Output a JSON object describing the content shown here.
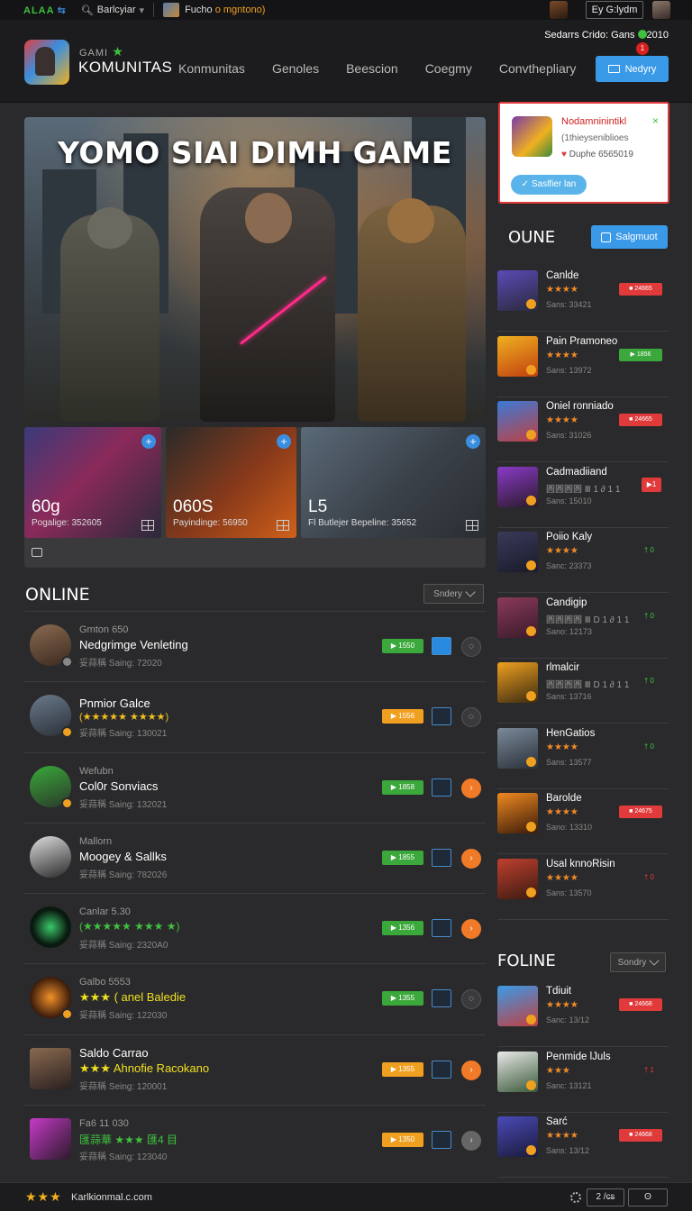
{
  "topbar": {
    "logo": "ALAA",
    "search_label": "Barlcyiar",
    "tab_text_prefix": "Fucho",
    "tab_text_suffix": "o mgntono)",
    "user_box": "Ey G:lydm"
  },
  "header": {
    "brand_small": "GAMI",
    "brand_title": "KOMUNITAS",
    "nav": [
      "Konmunitas",
      "Genoles",
      "Beescion",
      "Coegmy",
      "Convthepliary"
    ],
    "status": "Sedarrs Crido: Gans",
    "status_year": "2010",
    "notif_count": "1",
    "cta_label": "Nedyry"
  },
  "hero": {
    "title": "YOMO SIAI DIMH GAME"
  },
  "thumbs": [
    {
      "big": "60g",
      "sub": "Pogalige: 352605"
    },
    {
      "big": "060S",
      "sub": "Payindinge: 56950"
    },
    {
      "big": "L5",
      "sub": "Fl Butlejer Bepeline: 35652"
    }
  ],
  "online": {
    "title": "ONLINE",
    "sort_label": "Sndery",
    "rows": [
      {
        "pre": "Gmton 650",
        "name": "Nedgrimge Venleting",
        "meta": "妥蒜稱 Saing: 72020",
        "tag": "▶ 1550",
        "tag_color": "#3aa83a",
        "circle": "",
        "circle_style": ""
      },
      {
        "pre": "",
        "name": "Pnmior Galce",
        "stars": "(★★★★★ ★★★★)",
        "meta": "妥蒜稱 Saing: 130021",
        "tag": "▶ 1556",
        "tag_color": "#f0a020",
        "circle": "",
        "circle_style": ""
      },
      {
        "pre": "Wefubn",
        "name": "Col0r Sonviacs",
        "meta": "妥蒜稱 Saing: 132021",
        "tag": "▶ 1858",
        "tag_color": "#3aa83a",
        "circle": "›",
        "circle_style": "orange"
      },
      {
        "pre": "Mallorn",
        "name": "Moogey & Sallks",
        "meta": "妥蒜稱 Saing: 782026",
        "tag": "▶ 1855",
        "tag_color": "#3aa83a",
        "circle": "›",
        "circle_style": "orange"
      },
      {
        "pre": "Canlar 5.30",
        "name": "",
        "stars": "(★★★★★ ★★★ ★)",
        "meta": "妥蒜稱 Saing: 2320A0",
        "tag": "▶ 1356",
        "tag_color": "#3aa83a",
        "circle": "›",
        "circle_style": "orange"
      },
      {
        "pre": "Galbo 5553",
        "name": "★★★ ( anel Baledie",
        "meta": "妥蒜稱 Saing: 122030",
        "tag": "▶ 1355",
        "tag_color": "#3aa83a",
        "circle": "",
        "circle_style": ""
      },
      {
        "pre": "",
        "name": "Saldo Carrao",
        "name2": "★★★ Ahnofie Racokano",
        "meta": "妥蒜稱 Seing: 120001",
        "tag": "▶ 1355",
        "tag_color": "#f0a020",
        "circle": "›",
        "circle_style": "orange"
      },
      {
        "pre": "Fa6 11 030",
        "name": "",
        "stars": "匯蒜華 ★★★ 匯4 目",
        "meta": "妥蒜稱 Saing: 123040",
        "tag": "▶ 1350",
        "tag_color": "#f0a020",
        "circle": "›",
        "circle_style": "grey"
      }
    ]
  },
  "notification": {
    "title": "Nodamninintikl",
    "line2": "(1thieyseniblioes",
    "line3": "Duphe 6565019",
    "button": "Saslfier lan",
    "close": "×"
  },
  "right_online": {
    "title": "OUNE",
    "button": "Salgmuot",
    "items": [
      {
        "name": "Canlde",
        "stars": "★★★★",
        "meta": "Sans: 33421",
        "badge": "■ 24665",
        "badge_type": "red"
      },
      {
        "name": "Pain Pramoneo",
        "stars": "★★★★",
        "meta": "Sans: 13972",
        "badge": "▶ 1856",
        "badge_type": "green"
      },
      {
        "name": "Oniel ronniado",
        "stars": "★★★★",
        "meta": "Sans: 31026",
        "badge": "■ 24665",
        "badge_type": "red"
      },
      {
        "name": "Cadmadiiand",
        "stars": "圓圓圓圓 Ⅲ 1 ∂ 1 1",
        "meta": "Sans: 15010",
        "badge": "▶1",
        "badge_type": "redsq"
      },
      {
        "name": "Poiio Kaly",
        "stars": "★★★★",
        "meta": "Sanc: 23373",
        "badge": "† 0",
        "badge_type": "small"
      },
      {
        "name": "Candigip",
        "stars": "圓圓圓圓 Ⅲ D 1 ∂ 1 1",
        "meta": "Sano: 12173",
        "badge": "† 0",
        "badge_type": "small"
      },
      {
        "name": "rlmalcir",
        "stars": "圓圓圓圓 Ⅲ D 1 ∂ 1 1",
        "meta": "Sans: 13716",
        "badge": "† 0",
        "badge_type": "small"
      },
      {
        "name": "HenGatios",
        "stars": "★★★★",
        "meta": "Sans: 13577",
        "badge": "† 0",
        "badge_type": "small"
      },
      {
        "name": "Barolde",
        "stars": "★★★★",
        "meta": "Sano: 13310",
        "badge": "■ 24675",
        "badge_type": "red"
      },
      {
        "name": "Usal knnoRisin",
        "stars": "★★★★",
        "meta": "Sans: 13570",
        "badge": "† 0",
        "badge_type": "smallred"
      }
    ]
  },
  "right_offline": {
    "title": "FOLINE",
    "sort_label": "Sondry",
    "items": [
      {
        "name": "Tdiuit",
        "stars": "★★★★",
        "meta": "Sanc: 13/12",
        "badge": "■ 24668",
        "badge_type": "red"
      },
      {
        "name": "Penmide lJuls",
        "stars": "★★★",
        "meta": "Sanc: 13121",
        "badge": "† 1",
        "badge_type": "smallred"
      },
      {
        "name": "Sarć",
        "stars": "★★★★",
        "meta": "Sans: 13/12",
        "badge": "■ 24668",
        "badge_type": "red"
      }
    ]
  },
  "footer": {
    "stars": "★★★",
    "site": "Karlkionmal.c.com",
    "box1": "2 /ᴄ̶s",
    "box2": "ʘ"
  }
}
